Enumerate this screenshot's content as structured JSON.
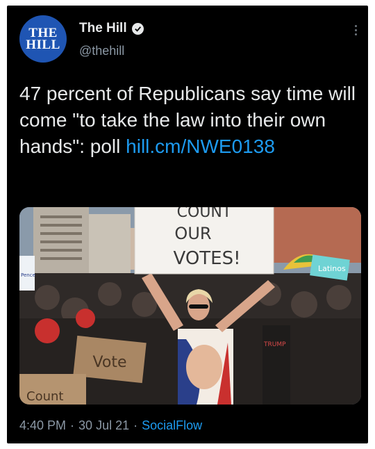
{
  "account": {
    "avatar_line1": "THE",
    "avatar_line2": "HILL",
    "display_name": "The Hill",
    "handle": "@thehill",
    "verified": true,
    "verified_icon": "verified-badge-icon"
  },
  "tweet": {
    "text": "47 percent of Republicans say time will come \"to take the law into their own hands\": poll ",
    "link": "hill.cm/NWE0138"
  },
  "media": {
    "sign_lines": [
      "COUNT",
      "OUR",
      "VOTES!"
    ],
    "cardboard_sign": "Vote",
    "corner_sign": "Count",
    "banner_text": "Latinos",
    "shirt_text": "TRUMP",
    "left_sign": "Pence"
  },
  "meta": {
    "time": "4:40 PM",
    "separator": "·",
    "date": "30 Jul 21",
    "source": "SocialFlow"
  },
  "colors": {
    "background": "#000000",
    "text": "#e7e9ea",
    "muted": "#8b98a5",
    "link": "#1d9bf0",
    "avatar": "#1f55b3"
  }
}
